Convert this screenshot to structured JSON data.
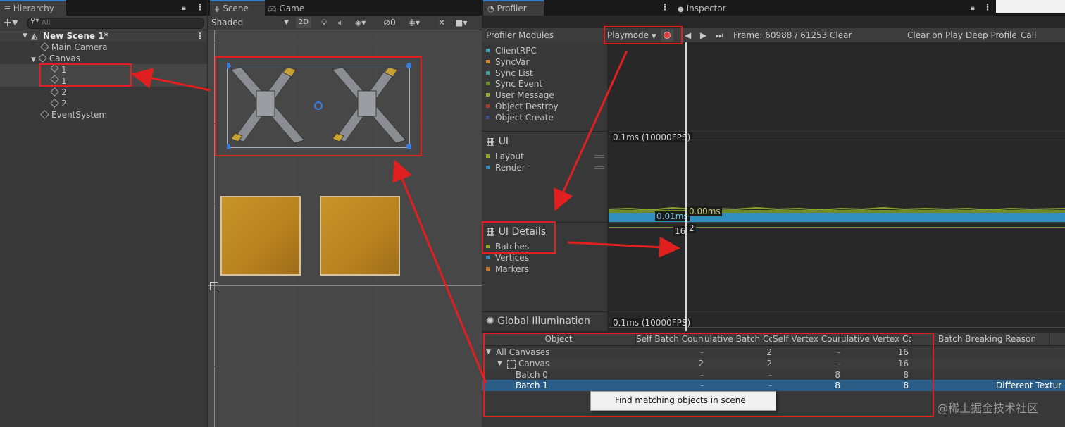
{
  "hierarchy": {
    "tab": "Hierarchy",
    "search_placeholder": "All",
    "scene": "New Scene 1*",
    "items": [
      "Main Camera",
      "Canvas",
      "1",
      "1",
      "2",
      "2",
      "EventSystem"
    ]
  },
  "scene": {
    "tab_scene": "Scene",
    "tab_game": "Game",
    "shading": "Shaded",
    "mode_2d": "2D",
    "hidden_count": "0"
  },
  "profiler": {
    "tab": "Profiler",
    "modules_label": "Profiler Modules",
    "playmode": "Playmode",
    "frame": "Frame: 60988 / 61253",
    "clear": "Clear",
    "clear_on_play": "Clear on Play",
    "deep_profile": "Deep Profile",
    "call_stacks": "Call Stacks",
    "network_items": [
      {
        "label": "ClientRPC",
        "color": "#4aa3c0"
      },
      {
        "label": "SyncVar",
        "color": "#d08a2a"
      },
      {
        "label": "Sync List",
        "color": "#3fa0a0"
      },
      {
        "label": "Sync Event",
        "color": "#6f8f2a"
      },
      {
        "label": "User Message",
        "color": "#9aa82a"
      },
      {
        "label": "Object Destroy",
        "color": "#b03a2a"
      },
      {
        "label": "Object Create",
        "color": "#3a4f8a"
      }
    ],
    "ui": {
      "title": "UI",
      "items": [
        {
          "label": "Layout",
          "color": "#8aa52a"
        },
        {
          "label": "Render",
          "color": "#2f8fbf"
        }
      ],
      "scale_label": "0.1ms (10000FPS)",
      "value_a": "0.01ms",
      "value_b": "0.00ms"
    },
    "ui_details": {
      "title": "UI Details",
      "items": [
        {
          "label": "Batches",
          "color": "#8aa52a"
        },
        {
          "label": "Vertices",
          "color": "#2f8fbf"
        },
        {
          "label": "Markers",
          "color": "#c97a2a"
        }
      ],
      "value_a": "16",
      "value_b": "2"
    },
    "gi": {
      "title": "Global Illumination",
      "scale_label": "0.1ms (10000FPS)"
    },
    "table": {
      "headers": [
        "Object",
        "Self Batch Count",
        "ulative Batch Co",
        "Self Vertex Coun",
        "ulative Vertex Co",
        "Batch Breaking Reason"
      ],
      "rows": [
        {
          "name": "All Canvases",
          "c1": "-",
          "c2": "2",
          "c3": "-",
          "c4": "16",
          "reason": ""
        },
        {
          "name": "Canvas",
          "c1": "2",
          "c2": "2",
          "c3": "-",
          "c4": "16",
          "reason": ""
        },
        {
          "name": "Batch 0",
          "c1": "-",
          "c2": "-",
          "c3": "8",
          "c4": "8",
          "reason": ""
        },
        {
          "name": "Batch 1",
          "c1": "-",
          "c2": "-",
          "c3": "8",
          "c4": "8",
          "reason": "Different Textur"
        }
      ],
      "context_menu": "Find matching objects in scene"
    }
  },
  "inspector": {
    "tab": "Inspector"
  },
  "watermark": "@稀土掘金技术社区"
}
